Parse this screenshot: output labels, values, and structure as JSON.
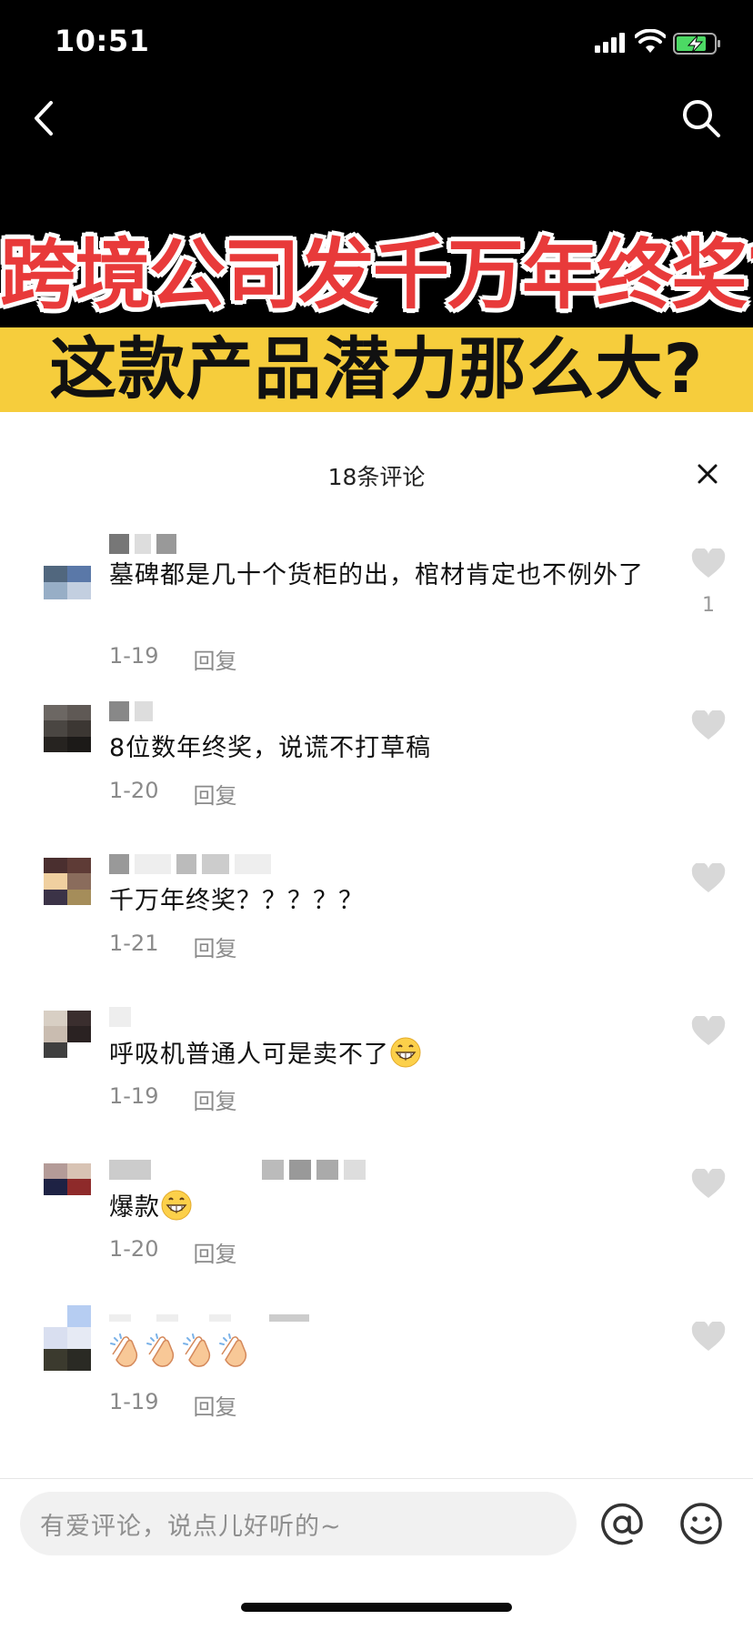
{
  "status_bar": {
    "time": "10:51"
  },
  "video": {
    "headline_line1": "跨境公司发千万年终奖?",
    "headline_line2": "这款产品潜力那么大?"
  },
  "comments_panel": {
    "title": "18条评论",
    "reply_label": "回复",
    "comments": [
      {
        "text": "墓碑都是几十个货柜的出，棺材肯定也不例外了",
        "date": "1-19",
        "likes": "1"
      },
      {
        "text": "8位数年终奖，说谎不打草稿",
        "date": "1-20",
        "likes": ""
      },
      {
        "text": "千万年终奖？？？？？",
        "date": "1-21",
        "likes": ""
      },
      {
        "text": "呼吸机普通人可是卖不了",
        "date": "1-19",
        "likes": "",
        "emoji": "grin-emoji"
      },
      {
        "text": "爆款",
        "date": "1-20",
        "likes": "",
        "emoji": "grin-emoji"
      },
      {
        "text": "",
        "date": "1-19",
        "likes": "",
        "emoji": "clap-emoji x4"
      }
    ]
  },
  "input": {
    "placeholder": "有爱评论，说点儿好听的~"
  },
  "icons": {
    "back": "chevron-left-icon",
    "search": "search-icon",
    "close": "close-icon",
    "like": "heart-icon",
    "at": "at-icon",
    "emoji": "smiley-icon"
  },
  "colors": {
    "headline_red": "#e83a3a",
    "headline_yellow": "#f6cd3c",
    "muted_text": "#8a8a8a",
    "heart_gray": "#d8d8d8"
  }
}
